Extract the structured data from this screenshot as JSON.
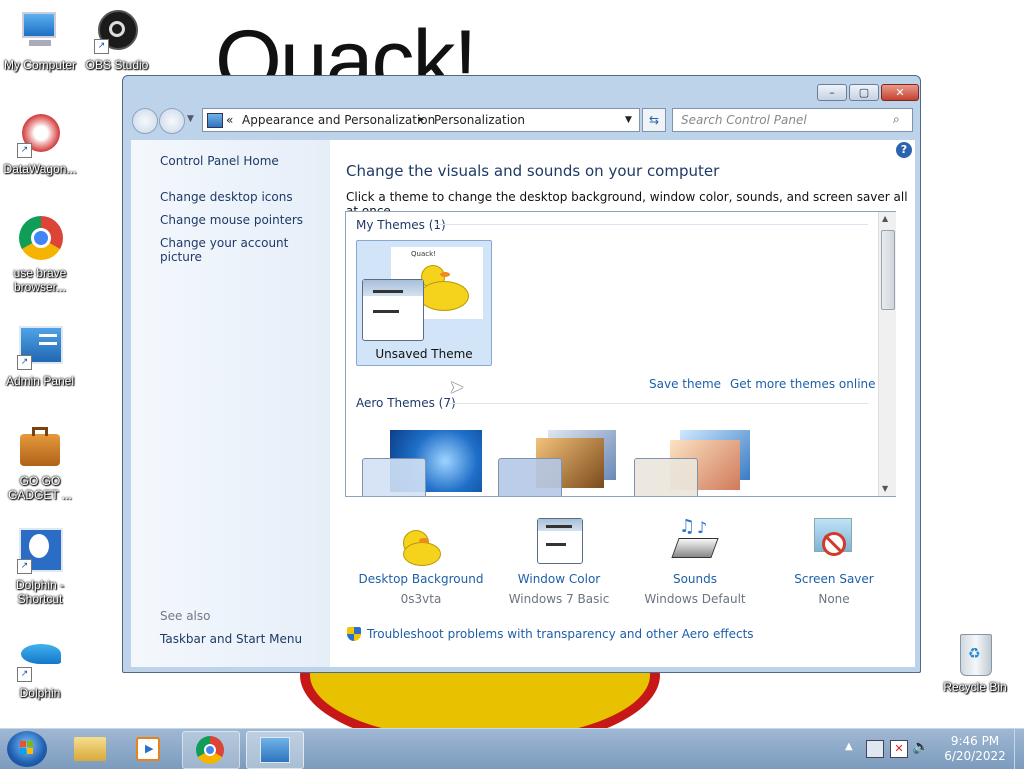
{
  "desktop": {
    "wallpaper_text": "Quack!",
    "icons": [
      {
        "label": "My Computer"
      },
      {
        "label": "OBS Studio"
      },
      {
        "label": "DataWagon..."
      },
      {
        "label": "use brave browser..."
      },
      {
        "label": "Admin Panel"
      },
      {
        "label": "GO GO GADGET ..."
      },
      {
        "label": "Dolphin - Shortcut"
      },
      {
        "label": "Dolphin"
      },
      {
        "label": "Recycle Bin"
      }
    ]
  },
  "window": {
    "address": {
      "root_chevron": "«",
      "crumb1": "Appearance and Personalization",
      "separator": "▸",
      "crumb2": "Personalization"
    },
    "search_placeholder": "Search Control Panel",
    "left": {
      "home": "Control Panel Home",
      "links": [
        "Change desktop icons",
        "Change mouse pointers",
        "Change your account picture"
      ],
      "see_also": "See also",
      "see_also_link": "Taskbar and Start Menu"
    },
    "main": {
      "title": "Change the visuals and sounds on your computer",
      "subtitle": "Click a theme to change the desktop background, window color, sounds, and screen saver all at once.",
      "my_themes_header": "My Themes (1)",
      "unsaved_theme": "Unsaved Theme",
      "thumb_text": "Quack!",
      "save_theme": "Save theme",
      "get_more": "Get more themes online",
      "aero_header": "Aero Themes (7)"
    },
    "settings": [
      {
        "title": "Desktop Background",
        "value": "0s3vta"
      },
      {
        "title": "Window Color",
        "value": "Windows 7 Basic"
      },
      {
        "title": "Sounds",
        "value": "Windows Default"
      },
      {
        "title": "Screen Saver",
        "value": "None"
      }
    ],
    "troubleshoot": "Troubleshoot problems with transparency and other Aero effects"
  },
  "taskbar": {
    "time": "9:46 PM",
    "date": "6/20/2022"
  },
  "colors": {
    "link": "#1e5fa8",
    "heading": "#1e3a66",
    "duck": "#f5d31c"
  }
}
